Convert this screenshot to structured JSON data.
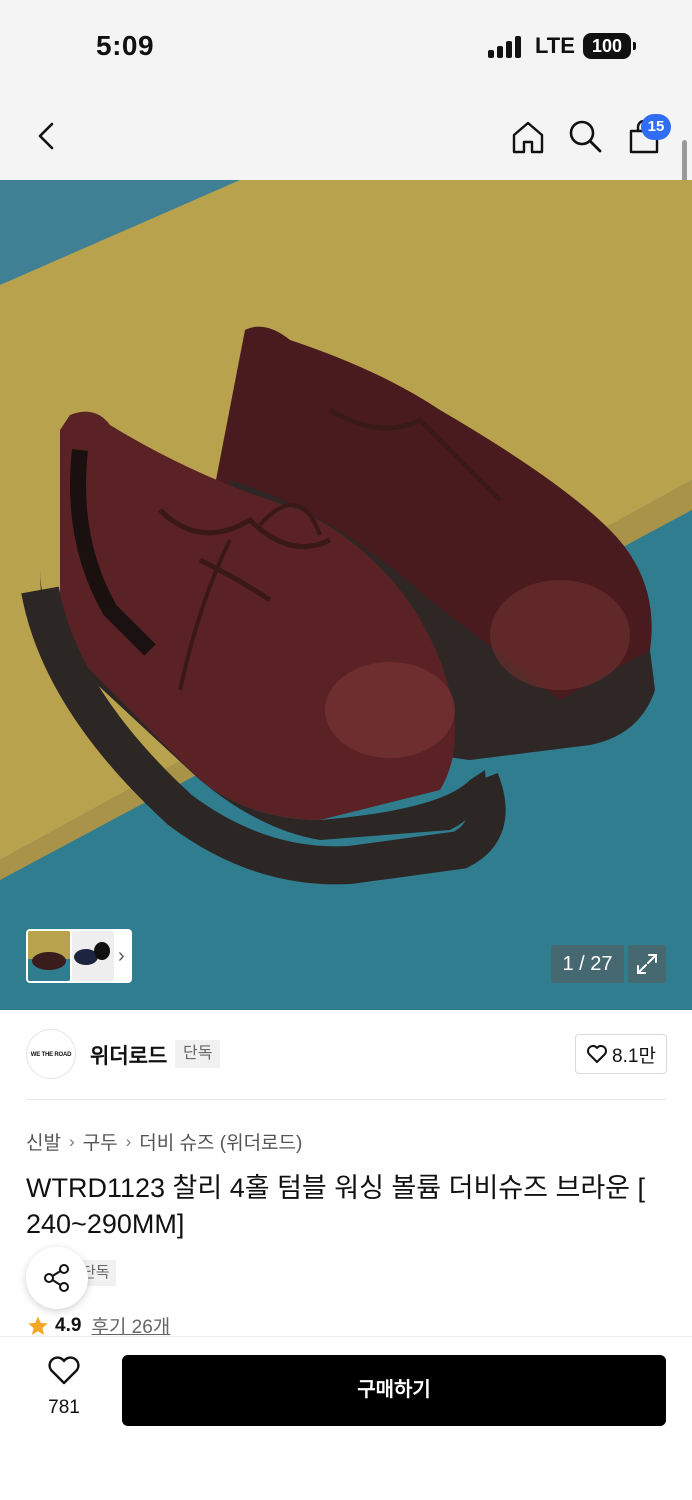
{
  "status_bar": {
    "time": "5:09",
    "network": "LTE",
    "battery": "100"
  },
  "nav": {
    "cart_count": "15",
    "icons": [
      "back-icon",
      "home-icon",
      "search-icon",
      "shopping-bag-icon"
    ]
  },
  "gallery": {
    "counter": "1 / 27"
  },
  "brand": {
    "logo_text": "WE THE ROAD",
    "name": "위더로드",
    "tag": "단독",
    "likes": "8.1만"
  },
  "breadcrumb": [
    "신발",
    "구두",
    "더비 슈즈 (위더로드)"
  ],
  "product": {
    "title": "WTRD1123 찰리 4홀 텀블 워싱 볼륨 더비슈즈 브라운 [ 240~290MM]",
    "exclusive_tag": "단독",
    "rating": "4.9",
    "reviews": "후기 26개"
  },
  "bottom": {
    "wish_count": "781",
    "buy_label": "구매하기"
  },
  "colors": {
    "accent_blue": "#2f6df6",
    "buy_button": "#000000",
    "star": "#f5a623"
  }
}
